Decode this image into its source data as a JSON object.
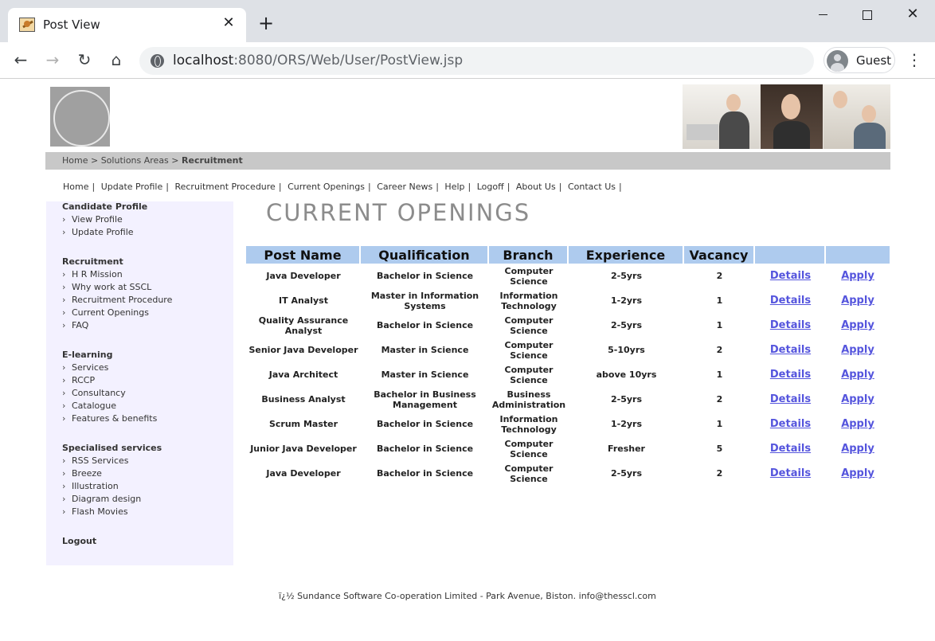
{
  "browser": {
    "tab_title": "Post View",
    "url_host": "localhost",
    "url_rest": ":8080/ORS/Web/User/PostView.jsp",
    "profile_label": "Guest"
  },
  "breadcrumb": {
    "home": "Home",
    "sep": ">",
    "solutions": "Solutions Areas",
    "current": "Recruitment"
  },
  "topnav": [
    "Home",
    "Update Profile",
    "Recruitment Procedure",
    "Current Openings",
    "Career News",
    "Help",
    "Logoff",
    "About Us",
    "Contact Us"
  ],
  "sidebar": {
    "candidate": {
      "heading": "Candidate Profile",
      "items": [
        "View Profile",
        "Update Profile"
      ]
    },
    "recruitment": {
      "heading": "Recruitment",
      "items": [
        "H R Mission",
        "Why work at SSCL",
        "Recruitment Procedure",
        "Current Openings",
        "FAQ"
      ]
    },
    "elearning": {
      "heading": "E-learning",
      "items": [
        "Services",
        "RCCP",
        "Consultancy",
        "Catalogue",
        "Features & benefits"
      ]
    },
    "specialised": {
      "heading": "Specialised services",
      "items": [
        "RSS Services",
        "Breeze",
        "Illustration",
        "Diagram design",
        "Flash Movies"
      ]
    },
    "logout": "Logout"
  },
  "main": {
    "title": "CURRENT OPENINGS",
    "columns": [
      "Post Name",
      "Qualification",
      "Branch",
      "Experience",
      "Vacancy",
      "",
      ""
    ],
    "details_label": "Details",
    "apply_label": "Apply",
    "rows": [
      [
        "Java Developer",
        "Bachelor in Science",
        "Computer Science",
        "2-5yrs",
        "2"
      ],
      [
        "IT Analyst",
        "Master in Information Systems",
        "Information Technology",
        "1-2yrs",
        "1"
      ],
      [
        "Quality Assurance Analyst",
        "Bachelor in Science",
        "Computer Science",
        "2-5yrs",
        "1"
      ],
      [
        "Senior Java Developer",
        "Master in Science",
        "Computer Science",
        "5-10yrs",
        "2"
      ],
      [
        "Java Architect",
        "Master in Science",
        "Computer Science",
        "above 10yrs",
        "1"
      ],
      [
        "Business Analyst",
        "Bachelor in Business Management",
        "Business Administration",
        "2-5yrs",
        "2"
      ],
      [
        "Scrum Master",
        "Bachelor in Science",
        "Information Technology",
        "1-2yrs",
        "1"
      ],
      [
        "Junior Java Developer",
        "Bachelor in Science",
        "Computer Science",
        "Fresher",
        "5"
      ],
      [
        "Java Developer",
        "Bachelor in Science",
        "Computer Science",
        "2-5yrs",
        "2"
      ]
    ]
  },
  "footer": "ï¿½ Sundance Software Co-operation Limited - Park Avenue, Biston. info@thesscl.com"
}
